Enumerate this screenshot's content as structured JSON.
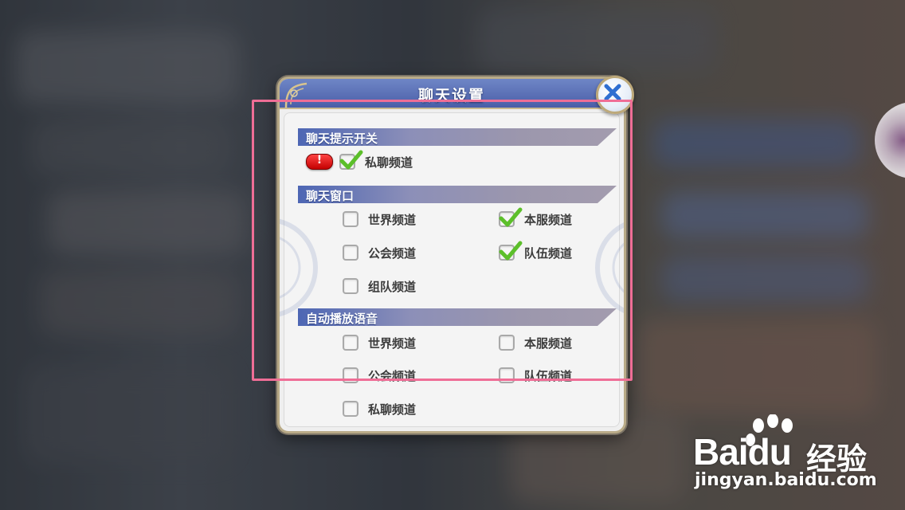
{
  "dialog": {
    "title": "聊天设置"
  },
  "sections": [
    {
      "header": "聊天提示开关",
      "alert_badge": "!",
      "options": [
        {
          "label": "私聊频道",
          "checked": true
        }
      ]
    },
    {
      "header": "聊天窗口",
      "options": [
        {
          "label": "世界频道",
          "checked": false
        },
        {
          "label": "本服频道",
          "checked": true
        },
        {
          "label": "公会频道",
          "checked": false
        },
        {
          "label": "队伍频道",
          "checked": true
        },
        {
          "label": "组队频道",
          "checked": false
        }
      ]
    },
    {
      "header": "自动播放语音",
      "options": [
        {
          "label": "世界频道",
          "checked": false
        },
        {
          "label": "本服频道",
          "checked": false
        },
        {
          "label": "公会频道",
          "checked": false
        },
        {
          "label": "队伍频道",
          "checked": false
        },
        {
          "label": "私聊频道",
          "checked": false
        }
      ]
    }
  ],
  "watermark": {
    "brand_left": "Bai",
    "brand_right": "du",
    "brand_cn": "经验",
    "url": "jingyan.baidu.com"
  },
  "colors": {
    "title_bar": "#4a5ea8",
    "check_green": "#5cbf2a",
    "highlight": "#ef6e96",
    "alert_red": "#d40000"
  },
  "icons": [
    "close-icon",
    "check-icon",
    "alert-icon",
    "corner-ornament-icon",
    "paw-logo-icon"
  ]
}
